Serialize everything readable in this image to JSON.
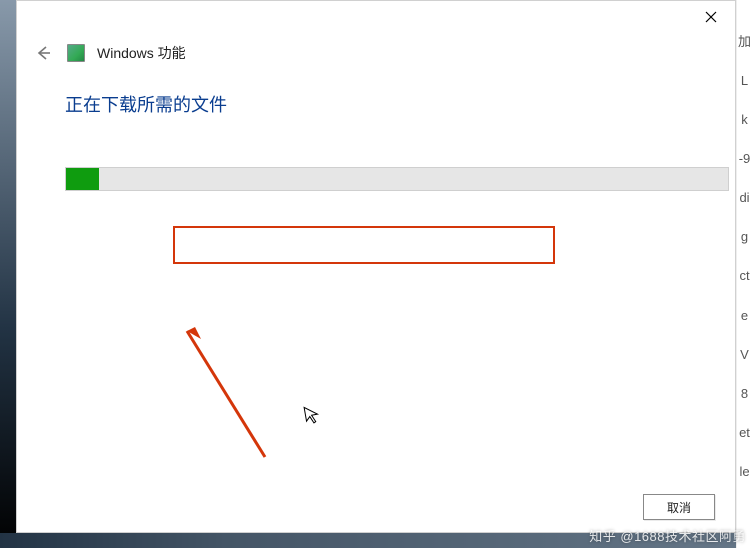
{
  "header": {
    "title": "Windows 功能"
  },
  "status": {
    "text": "正在下载所需的文件"
  },
  "progress": {
    "percent": 5
  },
  "buttons": {
    "cancel": "取消"
  },
  "watermark": "知乎 @1688技术社区阿勇",
  "right_fragments": [
    "加",
    "L",
    "k",
    "-9",
    "di",
    "g",
    "ct",
    "e",
    "V",
    "8",
    "et",
    "le"
  ]
}
